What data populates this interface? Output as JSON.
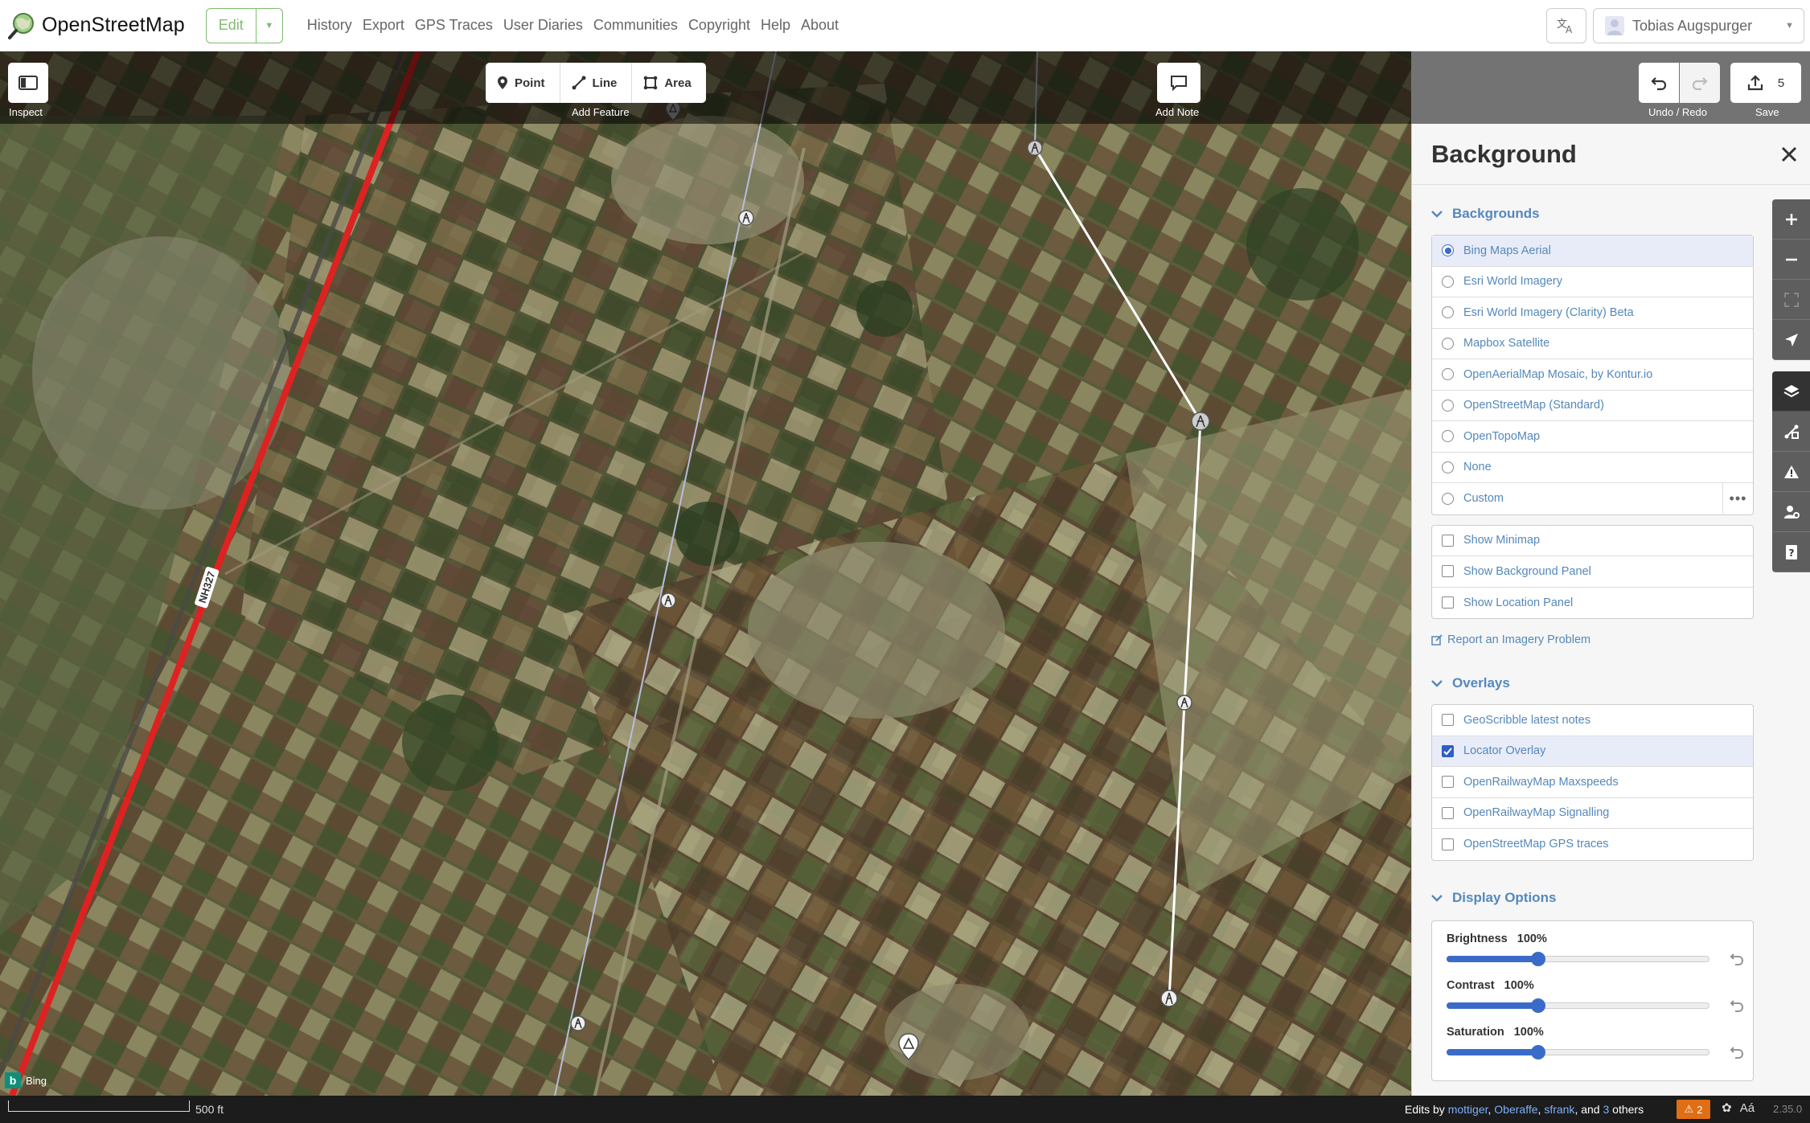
{
  "navbar": {
    "brand": "OpenStreetMap",
    "edit_label": "Edit",
    "links": [
      "History",
      "Export",
      "GPS Traces",
      "User Diaries",
      "Communities",
      "Copyright",
      "Help",
      "About"
    ],
    "user_name": "Tobias Augspurger"
  },
  "toolbar": {
    "inspect_label": "Inspect",
    "point_label": "Point",
    "line_label": "Line",
    "area_label": "Area",
    "add_feature_label": "Add Feature",
    "add_note_label": "Add Note",
    "undo_redo_label": "Undo / Redo",
    "save_label": "Save",
    "save_count": "5"
  },
  "map": {
    "road_label": "NH327"
  },
  "panel": {
    "title": "Background",
    "backgrounds_heading": "Backgrounds",
    "backgrounds": [
      {
        "label": "Bing Maps Aerial",
        "selected": true
      },
      {
        "label": "Esri World Imagery",
        "selected": false
      },
      {
        "label": "Esri World Imagery (Clarity) Beta",
        "selected": false
      },
      {
        "label": "Mapbox Satellite",
        "selected": false
      },
      {
        "label": "OpenAerialMap Mosaic, by Kontur.io",
        "selected": false
      },
      {
        "label": "OpenStreetMap (Standard)",
        "selected": false
      },
      {
        "label": "OpenTopoMap",
        "selected": false
      },
      {
        "label": "None",
        "selected": false
      },
      {
        "label": "Custom",
        "selected": false
      }
    ],
    "panel_toggles": [
      {
        "label": "Show Minimap",
        "checked": false
      },
      {
        "label": "Show Background Panel",
        "checked": false
      },
      {
        "label": "Show Location Panel",
        "checked": false
      }
    ],
    "report_link": "Report an Imagery Problem",
    "overlays_heading": "Overlays",
    "overlays": [
      {
        "label": "GeoScribble latest notes",
        "checked": false
      },
      {
        "label": "Locator Overlay",
        "checked": true
      },
      {
        "label": "OpenRailwayMap Maxspeeds",
        "checked": false
      },
      {
        "label": "OpenRailwayMap Signalling",
        "checked": false
      },
      {
        "label": "OpenStreetMap GPS traces",
        "checked": false
      }
    ],
    "display_heading": "Display Options",
    "sliders": [
      {
        "label": "Brightness",
        "value": "100%",
        "level": 0.35
      },
      {
        "label": "Contrast",
        "value": "100%",
        "level": 0.35
      },
      {
        "label": "Saturation",
        "value": "100%",
        "level": 0.35
      }
    ]
  },
  "footer": {
    "scale_label": "500 ft",
    "attribution_prefix": "Edits by",
    "editors": [
      "mottiger",
      "Oberaffe",
      "sfrank"
    ],
    "attribution_and": "and",
    "others_count": "3",
    "attribution_suffix": "others",
    "issues_count": "2",
    "version": "2.35.0",
    "imagery_provider": "Bing"
  },
  "colors": {
    "accent": "#7ebc6f",
    "link": "#5588bb",
    "selected": "#3a6bc9",
    "road": "#dd2222"
  }
}
